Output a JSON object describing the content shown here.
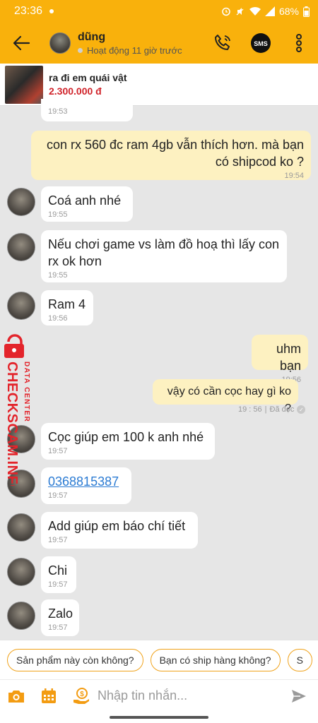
{
  "status_bar": {
    "time": "23:36",
    "battery": "68%"
  },
  "header": {
    "contact_name": "dũng",
    "activity": "Hoạt động 11 giờ trước",
    "sms_label": "SMS"
  },
  "product": {
    "name": "ra đi em quái vật",
    "price": "2.300.000 đ"
  },
  "messages": [
    {
      "side": "in",
      "text": "",
      "time": "19:53"
    },
    {
      "side": "out",
      "text": "con rx 560 đc ram 4gb vẫn thích hơn. mà bạn có shipcod ko ?",
      "time": "19:54"
    },
    {
      "side": "in",
      "text": "Coá anh nhé",
      "time": "19:55"
    },
    {
      "side": "in",
      "text": "Nếu chơi game vs làm đồ hoạ thì lấy con rx ok hơn",
      "time": "19:55"
    },
    {
      "side": "in",
      "text": "Ram 4",
      "time": "19:56"
    },
    {
      "side": "out",
      "text": "uhm bạn",
      "time": "19:56"
    },
    {
      "side": "out",
      "text": "vậy có cần cọc hay gì ko ?",
      "time": "19 : 56",
      "read_status": "Đã đọc"
    },
    {
      "side": "in",
      "text": "Cọc giúp em 100 k anh nhé",
      "time": "19:57"
    },
    {
      "side": "in",
      "text": "0368815387",
      "time": "19:57"
    },
    {
      "side": "in",
      "text": "Add giúp em báo chí tiết",
      "time": "19:57"
    },
    {
      "side": "in",
      "text": "Chi",
      "time": "19:57"
    },
    {
      "side": "in",
      "text": "Zalo",
      "time": "19:57"
    }
  ],
  "watermark": {
    "line1": "DATA CENTER",
    "line2": "CHECKSCAM.INFO",
    "color": "#e3242b"
  },
  "quick_replies": [
    "Sản phẩm này còn không?",
    "Bạn có ship hàng không?",
    "S"
  ],
  "composer": {
    "placeholder": "Nhập tin nhắn..."
  },
  "colors": {
    "brand": "#f9b10c",
    "outgoing_bubble": "#fdf1c1",
    "price": "#d0232a",
    "link": "#2b7bd3"
  }
}
